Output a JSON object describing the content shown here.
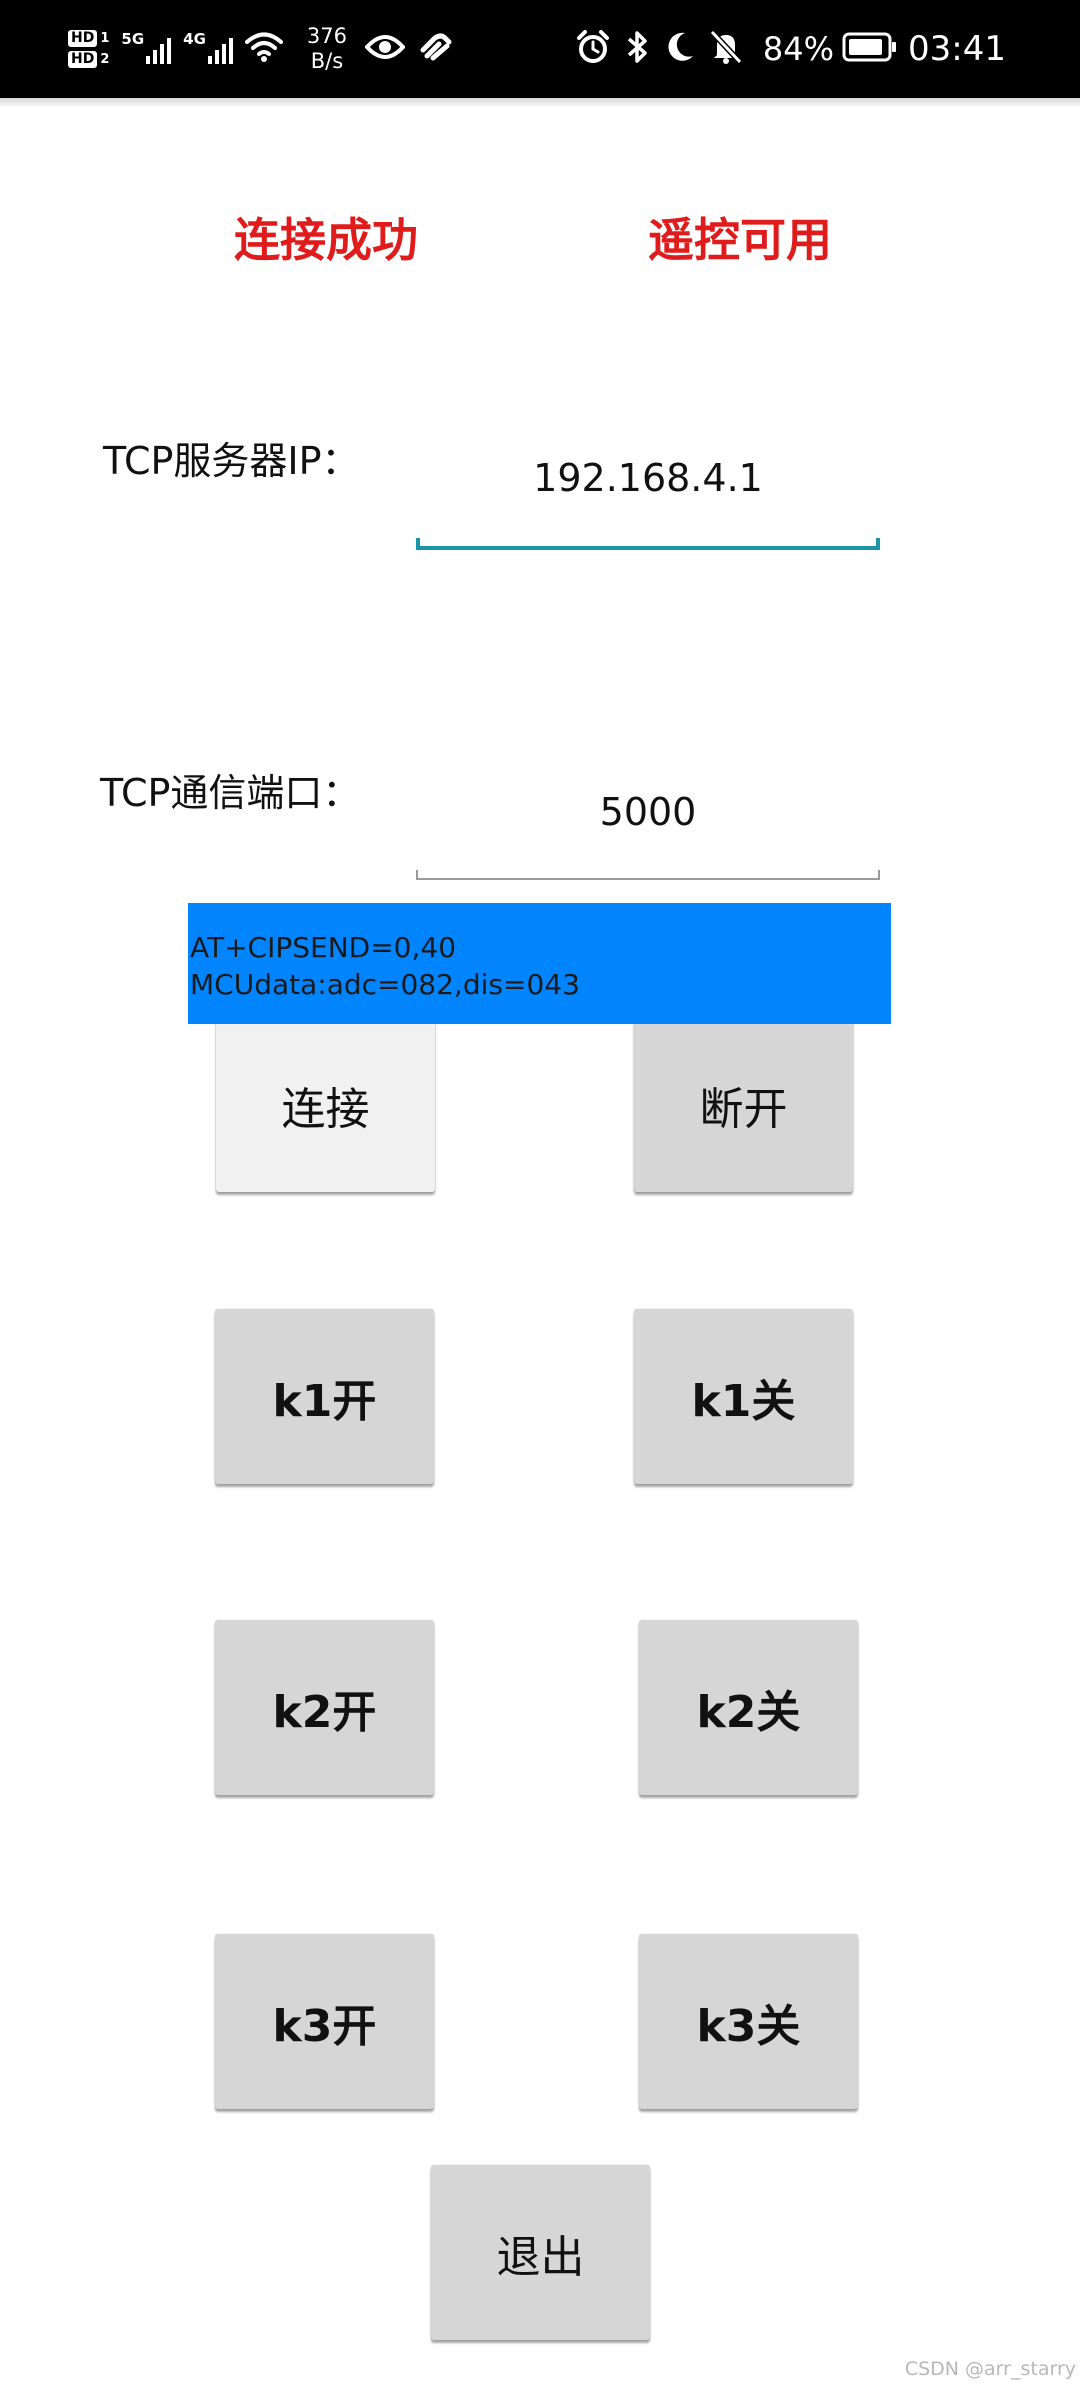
{
  "status_bar": {
    "hd1": "HD",
    "hd1_slot": "1",
    "hd2": "HD",
    "hd2_slot": "2",
    "network1": "5G",
    "network2": "4G",
    "speed_value": "376",
    "speed_unit": "B/s",
    "battery_percent": "84%",
    "time": "03:41"
  },
  "status": {
    "connection": "连接成功",
    "remote": "遥控可用"
  },
  "fields": {
    "ip_label": "TCP服务器IP：",
    "ip_value": "192.168.4.1",
    "port_label": "TCP通信端口：",
    "port_value": "5000"
  },
  "log": {
    "line1": "AT+CIPSEND=0,40",
    "line2": "MCUdata:adc=082,dis=043"
  },
  "buttons": {
    "connect": "连接",
    "disconnect": "断开",
    "k1_on": "k1开",
    "k1_off": "k1关",
    "k2_on": "k2开",
    "k2_off": "k2关",
    "k3_on": "k3开",
    "k3_off": "k3关",
    "exit": "退出"
  },
  "watermark": "CSDN @arr_starry",
  "colors": {
    "status_text": "#e01b1b",
    "log_background": "#0085ff",
    "input_focus": "#1b96a8",
    "button": "#d6d6d6",
    "button_pressed": "#f1f1f1"
  }
}
